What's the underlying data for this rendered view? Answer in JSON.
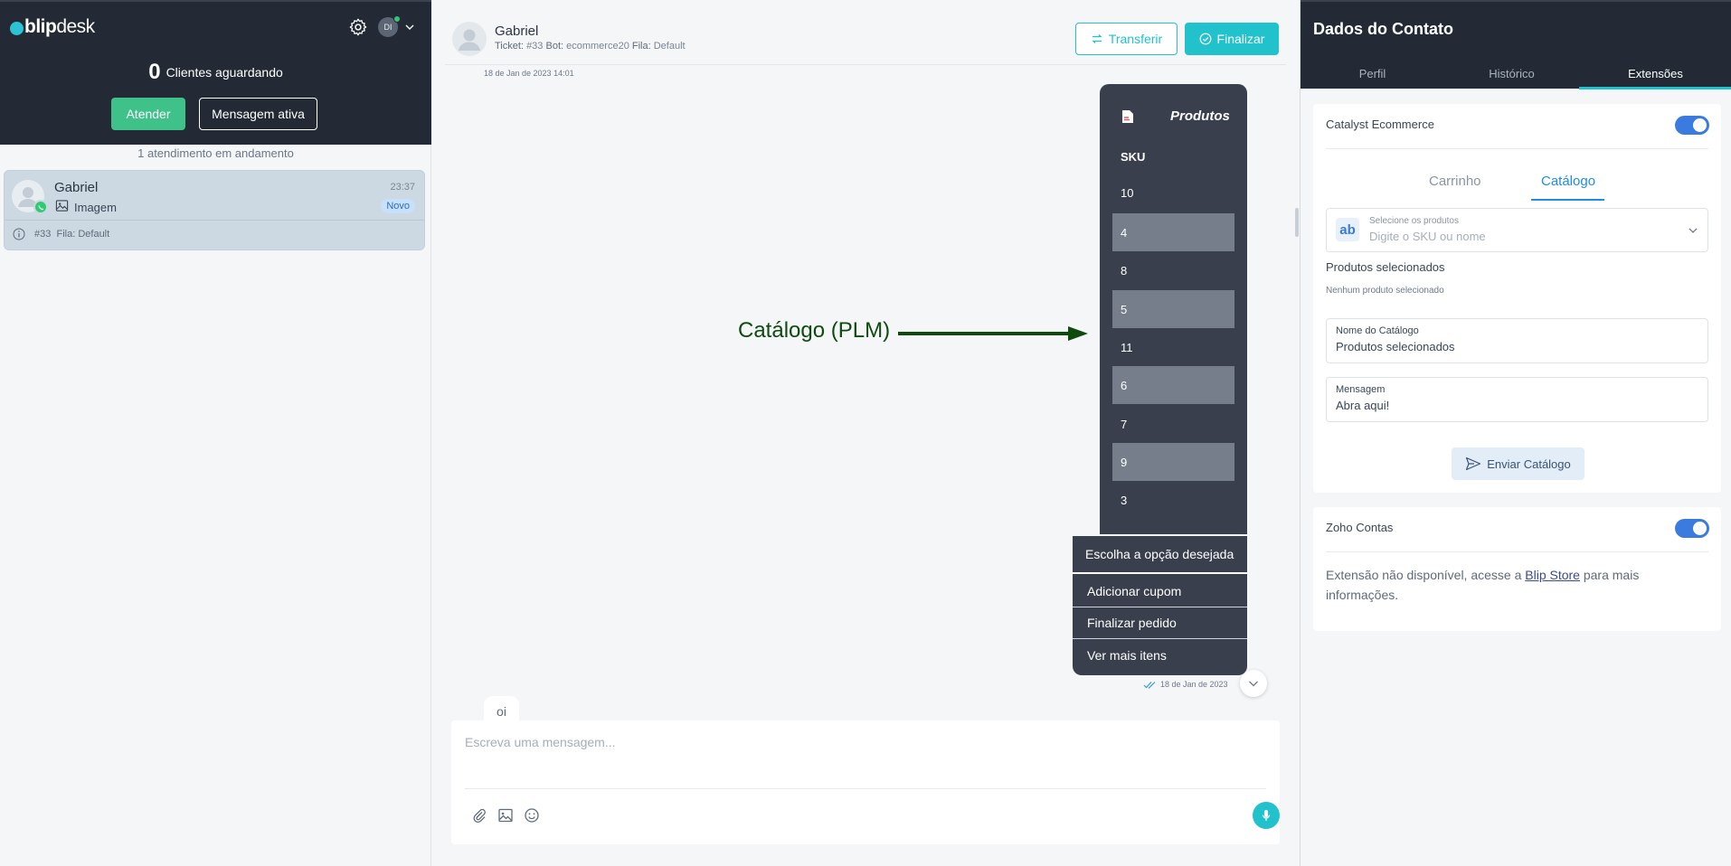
{
  "left": {
    "logo_blip": "blip",
    "logo_desk": "desk",
    "avatar_initials": "DI",
    "waiting_count": "0",
    "waiting_label": "Clientes aguardando",
    "btn_atender": "Atender",
    "btn_mensagem": "Mensagem ativa",
    "in_progress": "1 atendimento em andamento",
    "conversation": {
      "name": "Gabriel",
      "time": "23:37",
      "message": "Imagem",
      "badge": "Novo",
      "ticket": "#33",
      "queue_label": "Fila:",
      "queue": "Default"
    }
  },
  "chat": {
    "contact_name": "Gabriel",
    "ticket_label": "Ticket:",
    "ticket": "#33",
    "bot_label": "Bot:",
    "bot": "ecommerce20",
    "queue_label": "Fila:",
    "queue": "Default",
    "btn_transferir": "Transferir",
    "btn_finalizar": "Finalizar",
    "date_top": "18 de Jan de 2023 14:01",
    "products": {
      "title": "Produtos",
      "column": "SKU",
      "rows": [
        "10",
        "4",
        "8",
        "5",
        "11",
        "6",
        "7",
        "9",
        "3"
      ]
    },
    "options": {
      "title": "Escolha a opção desejada",
      "items": [
        "Adicionar cupom",
        "Finalizar pedido",
        "Ver mais itens"
      ]
    },
    "date_bottom": "18 de Jan de 2023",
    "incoming_message": "oi",
    "annotation": "Catálogo (PLM)",
    "composer_placeholder": "Escreva uma mensagem..."
  },
  "right": {
    "title": "Dados do Contato",
    "tabs": [
      "Perfil",
      "Histórico",
      "Extensões"
    ],
    "active_tab": "Extensões",
    "catalyst": {
      "title": "Catalyst Ecommerce",
      "subtabs": [
        "Carrinho",
        "Catálogo"
      ],
      "active_subtab": "Catálogo",
      "select_icon": "ab",
      "select_label": "Selecione os produtos",
      "select_placeholder": "Digite o SKU ou nome",
      "selected_label": "Produtos selecionados",
      "selected_empty": "Nenhum produto selecionado",
      "catalog_name_label": "Nome do Catálogo",
      "catalog_name_value": "Produtos selecionados",
      "message_label": "Mensagem",
      "message_value": "Abra aqui!",
      "btn_enviar": "Enviar Catálogo"
    },
    "zoho": {
      "title": "Zoho Contas",
      "text_before": "Extensão não disponível, acesse a ",
      "link": "Blip Store",
      "text_after": " para mais informações."
    }
  },
  "colors": {
    "dark_header": "#232a36",
    "accent_teal": "#21c2cb",
    "green": "#3fc28a",
    "toggle_blue": "#3b7be0",
    "bubble_dark": "#3a3f4d",
    "annotation_green": "#0f4a0f"
  },
  "icons": [
    "gear-icon",
    "chevron-down-icon",
    "whatsapp-icon",
    "image-icon",
    "info-icon",
    "transfer-icon",
    "check-circle-icon",
    "document-icon",
    "double-check-icon",
    "attach-icon",
    "emoji-icon",
    "mic-icon",
    "send-icon"
  ]
}
